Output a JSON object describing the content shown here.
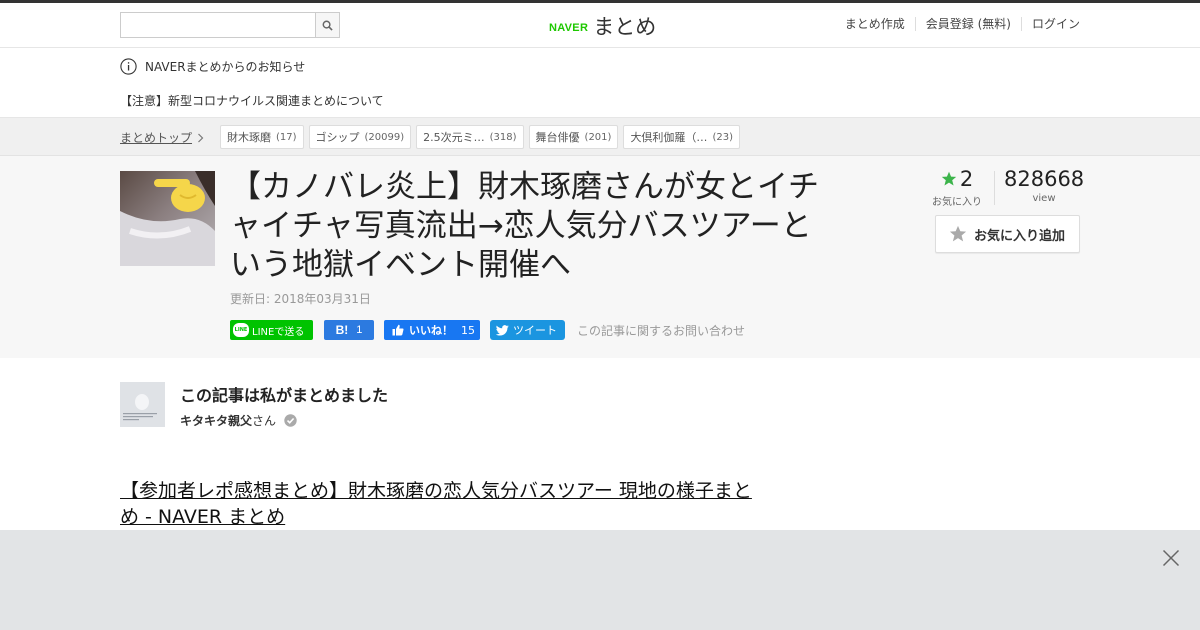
{
  "header": {
    "search": {
      "value": "",
      "placeholder": ""
    },
    "logo": {
      "brand": "NAVER",
      "service": "まとめ"
    },
    "nav": [
      "まとめ作成",
      "会員登録 (無料)",
      "ログイン"
    ]
  },
  "notice": {
    "heading": "NAVERまとめからのお知らせ",
    "link": "【注意】新型コロナウイルス関連まとめについて"
  },
  "breadcrumb": {
    "top": "まとめトップ",
    "tags": [
      {
        "label": "財木琢磨",
        "count": "(17)"
      },
      {
        "label": "ゴシップ",
        "count": "(20099)"
      },
      {
        "label": "2.5次元ミ…",
        "count": "(318)"
      },
      {
        "label": "舞台俳優",
        "count": "(201)"
      },
      {
        "label": "大倶利伽羅（…",
        "count": "(23)"
      }
    ]
  },
  "article": {
    "title": "【カノバレ炎上】財木琢磨さんが女とイチャイチャ写真流出→恋人気分バスツアーという地獄イベント開催へ",
    "updated": "更新日: 2018年03月31日",
    "favorites": {
      "count": "2",
      "label": "お気に入り"
    },
    "views": {
      "count": "828668",
      "label": "view"
    },
    "fav_button": "お気に入り追加",
    "share": {
      "line": "LINEで送る",
      "line_icon": "LINE",
      "hatena_icon": "B!",
      "hatena_count": "1",
      "fb": "いいね！",
      "fb_count": "15",
      "tweet": "ツイート"
    },
    "inquiry": "この記事に関するお問い合わせ"
  },
  "author": {
    "heading": "この記事は私がまとめました",
    "name": "キタキタ親父",
    "suffix": "さん"
  },
  "related": {
    "link": "【参加者レポ感想まとめ】財木琢磨の恋人気分バスツアー 現地の様子まとめ - NAVER まとめ"
  },
  "colors": {
    "naver_green": "#1ec800",
    "line_green": "#00c300",
    "hatena_blue": "#2c7ae0",
    "facebook_blue": "#1877f2",
    "twitter_blue": "#1b95e0",
    "star_green": "#3cb44b"
  },
  "icons": [
    "search-icon",
    "info-icon",
    "chevron-right-icon",
    "star-icon",
    "thumbs-up-icon",
    "twitter-bird-icon",
    "verified-check-icon",
    "close-icon"
  ]
}
